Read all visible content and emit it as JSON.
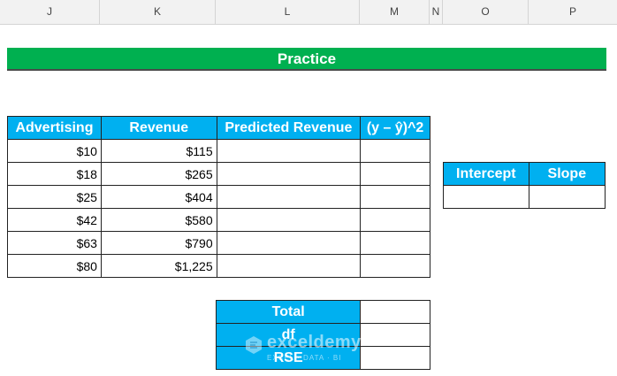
{
  "columns": [
    "J",
    "K",
    "L",
    "M",
    "N",
    "O",
    "P"
  ],
  "banner": "Practice",
  "main_table": {
    "headers": [
      "Advertising",
      "Revenue",
      "Predicted Revenue",
      "(y – ŷ)^2"
    ],
    "rows": [
      [
        "$10",
        "$115",
        "",
        ""
      ],
      [
        "$18",
        "$265",
        "",
        ""
      ],
      [
        "$25",
        "$404",
        "",
        ""
      ],
      [
        "$42",
        "$580",
        "",
        ""
      ],
      [
        "$63",
        "$790",
        "",
        ""
      ],
      [
        "$80",
        "$1,225",
        "",
        ""
      ]
    ]
  },
  "coef_table": {
    "headers": [
      "Intercept",
      "Slope"
    ],
    "values": [
      "",
      ""
    ]
  },
  "summary_table": {
    "labels": [
      "Total",
      "df",
      "RSE"
    ],
    "values": [
      "",
      "",
      ""
    ]
  },
  "watermark": {
    "brand": "exceldemy",
    "tagline": "EXCEL · DATA · BI"
  }
}
